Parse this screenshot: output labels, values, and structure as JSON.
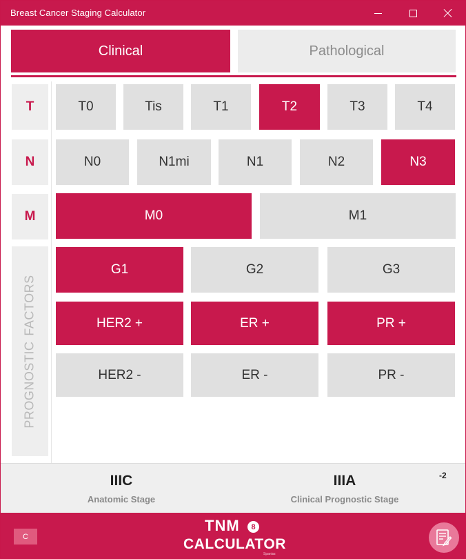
{
  "window": {
    "title": "Breast Cancer Staging Calculator",
    "accent_color": "#c8194d"
  },
  "tabs": [
    {
      "label": "Clinical",
      "active": true
    },
    {
      "label": "Pathological",
      "active": false
    }
  ],
  "rows": {
    "t": {
      "label": "T",
      "options": [
        {
          "label": "T0",
          "selected": false
        },
        {
          "label": "Tis",
          "selected": false
        },
        {
          "label": "T1",
          "selected": false
        },
        {
          "label": "T2",
          "selected": true
        },
        {
          "label": "T3",
          "selected": false
        },
        {
          "label": "T4",
          "selected": false
        }
      ]
    },
    "n": {
      "label": "N",
      "options": [
        {
          "label": "N0",
          "selected": false
        },
        {
          "label": "N1mi",
          "selected": false
        },
        {
          "label": "N1",
          "selected": false
        },
        {
          "label": "N2",
          "selected": false
        },
        {
          "label": "N3",
          "selected": true
        }
      ]
    },
    "m": {
      "label": "M",
      "options": [
        {
          "label": "M0",
          "selected": true
        },
        {
          "label": "M1",
          "selected": false
        }
      ]
    },
    "prognostic": {
      "label_words": [
        "PROGNOSTIC",
        "FACTORS"
      ],
      "grade": [
        {
          "label": "G1",
          "selected": true
        },
        {
          "label": "G2",
          "selected": false
        },
        {
          "label": "G3",
          "selected": false
        }
      ],
      "positive": [
        {
          "label": "HER2 +",
          "selected": true
        },
        {
          "label": "ER +",
          "selected": true
        },
        {
          "label": "PR +",
          "selected": true
        }
      ],
      "negative": [
        {
          "label": "HER2 -",
          "selected": false
        },
        {
          "label": "ER -",
          "selected": false
        },
        {
          "label": "PR -",
          "selected": false
        }
      ]
    }
  },
  "result": {
    "anatomic_value": "IIIC",
    "anatomic_label": "Anatomic Stage",
    "prognostic_value": "IIIA",
    "prognostic_label": "Clinical Prognostic Stage",
    "superscript": "-2"
  },
  "footer": {
    "c_button_label": "C",
    "logo_top": "TNM",
    "logo_edition": "8",
    "logo_bottom": "CALCULATOR",
    "logo_small": "Spanisz",
    "note_icon": "notepad-pencil-icon"
  }
}
